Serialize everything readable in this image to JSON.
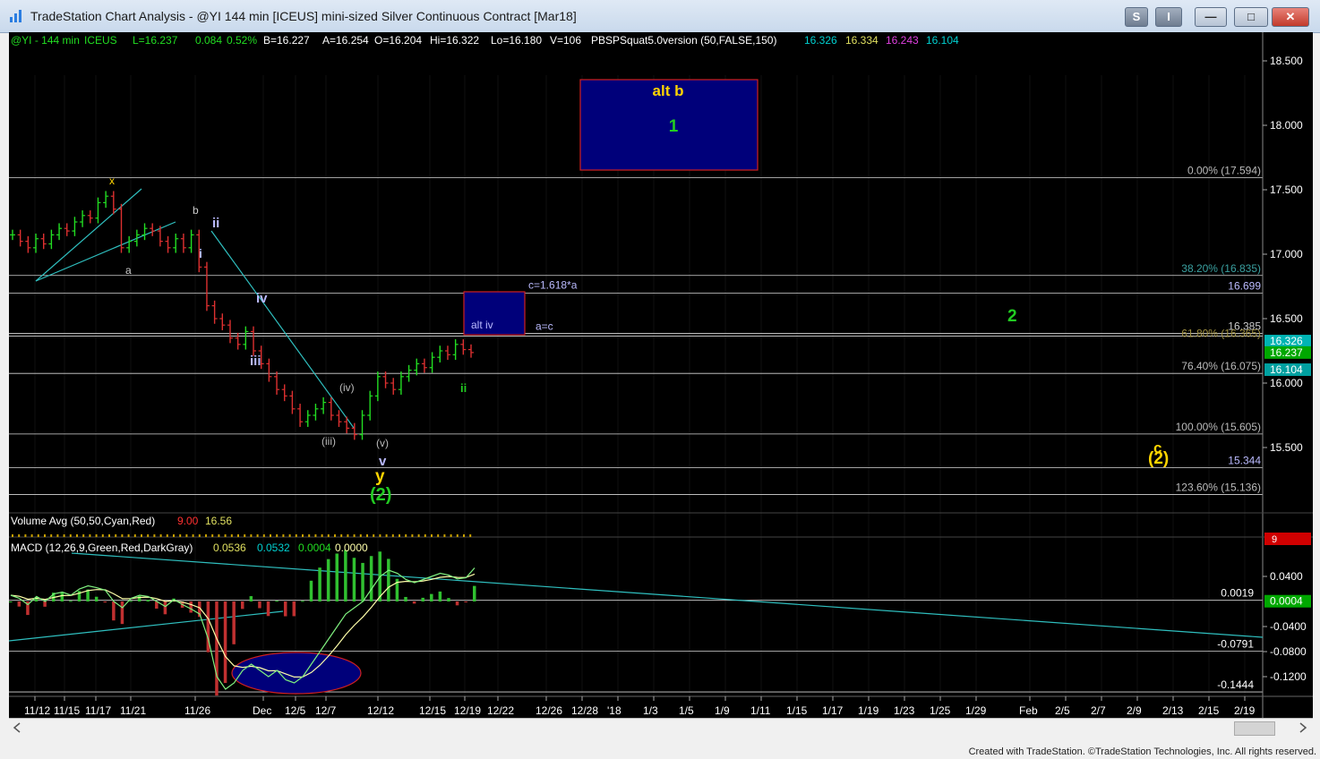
{
  "window": {
    "title": "TradeStation Chart Analysis - @YI 144 min [ICEUS] mini-sized Silver Continuous Contract [Mar18]",
    "btn_s": "S",
    "btn_i": "I",
    "btn_min": "—",
    "btn_max": "□",
    "btn_close": "✕",
    "footer": "Created with TradeStation. ©TradeStation Technologies, Inc. All rights reserved."
  },
  "status": {
    "symbol": "@YI - 144 min",
    "exchange": "ICEUS",
    "last": "L=16.237",
    "change": "0.084",
    "pct": "0.52%",
    "bid": "B=16.227",
    "ask": "A=16.254",
    "open": "O=16.204",
    "high": "Hi=16.322",
    "low": "Lo=16.180",
    "vol": "V=106",
    "indicator": "PBSPSquat5.0version (50,FALSE,150)",
    "v1": "16.326",
    "v2": "16.334",
    "v3": "16.243",
    "v4": "16.104"
  },
  "volume_header": {
    "label": "Volume Avg (50,50,Cyan,Red)",
    "v1": "9.00",
    "v2": "16.56",
    "axis_value": "9"
  },
  "macd_header": {
    "label": "MACD (12,26,9,Green,Red,DarkGray)",
    "v1": "0.0536",
    "v2": "0.0532",
    "v3": "0.0004",
    "v4": "0.0000"
  },
  "colors": {
    "background": "#000000",
    "up_bar": "#22dd22",
    "down_bar": "#dd3030",
    "trendline": "#2fbfbf",
    "box_fill": "#00007a",
    "box_border": "#d02020",
    "label_green": "#22cc22",
    "label_yellow": "#ffd500"
  },
  "boxes": {
    "alt_b": {
      "top": "alt b",
      "bottom": "1"
    },
    "alt_iv": "alt iv"
  },
  "wave_labels": {
    "x": "x",
    "a": "a",
    "b": "b",
    "ii_major": "ii",
    "i": "i",
    "iv": "iv",
    "iii": "iii",
    "iii_minor": "(iii)",
    "iv_minor": "(iv)",
    "v_minor": "(v)",
    "v": "v",
    "y": "y",
    "two_major": "(2)",
    "ii_small": "ii",
    "label_2": "2",
    "c_future": "c",
    "two_future": "(2)"
  },
  "chart_data": {
    "type": "line",
    "title": "@YI 144 min [ICEUS] mini-sized Silver Continuous Contract [Mar18]",
    "price_axis": {
      "min": 15.0,
      "max": 18.6,
      "ticks": [
        {
          "label": "18.500",
          "value": 18.5
        },
        {
          "label": "18.000",
          "value": 18.0
        },
        {
          "label": "17.500",
          "value": 17.5
        },
        {
          "label": "17.000",
          "value": 17.0
        },
        {
          "label": "16.500",
          "value": 16.5
        },
        {
          "label": "16.000",
          "value": 16.0
        },
        {
          "label": "15.500",
          "value": 15.5
        }
      ],
      "price_tags": [
        {
          "label": "16.326",
          "value": 16.326,
          "color": "#00b4b4"
        },
        {
          "label": "16.237",
          "value": 16.237,
          "color": "#00a800"
        },
        {
          "label": "16.104",
          "value": 16.104,
          "color": "#00a0a0"
        }
      ]
    },
    "fib_levels": [
      {
        "label": "0.00% (17.594)",
        "value": 17.594,
        "color": "#bbbbbb"
      },
      {
        "label": "38.20% (16.835)",
        "value": 16.835,
        "color": "#3aa0a0"
      },
      {
        "label": "16.699",
        "value": 16.699,
        "color": "#bbbbff"
      },
      {
        "label": "16.385",
        "value": 16.385,
        "color": "#cccccc"
      },
      {
        "label": "61.80% (16.365)",
        "value": 16.365,
        "color": "#a09040"
      },
      {
        "label": "76.40% (16.075)",
        "value": 16.075,
        "color": "#bbbbbb"
      },
      {
        "label": "100.00% (15.605)",
        "value": 15.605,
        "color": "#bbbbbb"
      },
      {
        "label": "15.344",
        "value": 15.344,
        "color": "#bbbbff"
      },
      {
        "label": "123.60% (15.136)",
        "value": 15.136,
        "color": "#bbbbbb"
      }
    ],
    "annotations": [
      {
        "text": "c=1.618*a",
        "value": 16.699
      },
      {
        "text": "a=c",
        "value": 16.385
      }
    ],
    "x_axis": [
      "11/12",
      "11/15",
      "11/17",
      "11/21",
      "11/26",
      "Dec",
      "12/5",
      "12/7",
      "12/12",
      "12/15",
      "12/19",
      "12/22",
      "12/26",
      "12/28",
      "'18",
      "1/3",
      "1/5",
      "1/9",
      "1/11",
      "1/15",
      "1/17",
      "1/19",
      "1/23",
      "1/25",
      "1/29",
      "Feb",
      "2/5",
      "2/7",
      "2/9",
      "2/13",
      "2/15",
      "2/19"
    ],
    "series": [
      {
        "values": [
          17.15,
          17.1,
          17.05,
          17.12,
          17.08,
          17.15,
          17.2,
          17.18,
          17.25,
          17.3,
          17.28,
          17.4,
          17.45,
          17.35,
          17.05,
          17.1,
          17.15,
          17.2,
          17.18,
          17.1,
          17.05,
          17.12,
          17.05,
          17.15,
          16.9,
          16.6,
          16.5,
          16.45,
          16.35,
          16.3,
          16.4,
          16.25,
          16.15,
          16.05,
          15.95,
          15.9,
          15.8,
          15.7,
          15.75,
          15.8,
          15.85,
          15.75,
          15.7,
          15.65,
          15.6,
          15.75,
          15.9,
          16.05,
          16.0,
          15.95,
          16.05,
          16.1,
          16.15,
          16.12,
          16.2,
          16.25,
          16.22,
          16.3,
          16.26,
          16.237
        ]
      }
    ],
    "macd": {
      "axis_min": -0.17,
      "axis_max": 0.075,
      "ticks": [
        {
          "label": "0.0400",
          "value": 0.04
        },
        {
          "label": "-0.0400",
          "value": -0.04
        },
        {
          "label": "-0.0800",
          "value": -0.08
        },
        {
          "label": "-0.1200",
          "value": -0.12
        }
      ],
      "levels": [
        {
          "label": "0.0019",
          "value": 0.0019
        },
        {
          "label": "-0.0791",
          "value": -0.0791
        },
        {
          "label": "-0.1444",
          "value": -0.1444
        }
      ],
      "current": {
        "label": "0.0004",
        "value": 0.0004
      },
      "line": [
        0.01,
        0.005,
        -0.005,
        0.008,
        0.0,
        0.012,
        0.015,
        0.01,
        0.02,
        0.025,
        0.022,
        0.018,
        0.0,
        -0.01,
        0.005,
        0.01,
        0.008,
        0.0,
        -0.008,
        0.003,
        -0.005,
        -0.012,
        -0.02,
        -0.06,
        -0.12,
        -0.14,
        -0.13,
        -0.11,
        -0.1,
        -0.11,
        -0.12,
        -0.11,
        -0.125,
        -0.13,
        -0.12,
        -0.1,
        -0.08,
        -0.06,
        -0.04,
        -0.02,
        -0.01,
        0.0,
        0.02,
        0.04,
        0.05,
        0.045,
        0.035,
        0.03,
        0.035,
        0.04,
        0.045,
        0.042,
        0.036,
        0.038,
        0.0536
      ]
    }
  }
}
